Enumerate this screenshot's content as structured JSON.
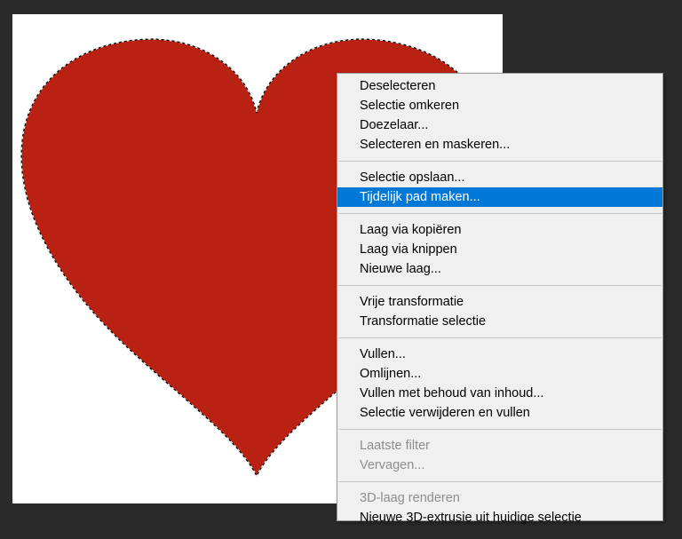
{
  "colors": {
    "workspace_background": "#2b2b2b",
    "canvas_background": "#ffffff",
    "heart_fill": "#b92213",
    "menu_background": "#f0f0f0",
    "menu_highlight": "#0078d7",
    "menu_text": "#000000",
    "menu_text_disabled": "#8d8d8d"
  },
  "canvas": {
    "shape": "heart-icon",
    "selection": "marching-ants"
  },
  "context_menu": {
    "groups": [
      [
        {
          "label": "Deselecteren",
          "enabled": true,
          "highlighted": false
        },
        {
          "label": "Selectie omkeren",
          "enabled": true,
          "highlighted": false
        },
        {
          "label": "Doezelaar...",
          "enabled": true,
          "highlighted": false
        },
        {
          "label": "Selecteren en maskeren...",
          "enabled": true,
          "highlighted": false
        }
      ],
      [
        {
          "label": "Selectie opslaan...",
          "enabled": true,
          "highlighted": false
        },
        {
          "label": "Tijdelijk pad maken...",
          "enabled": true,
          "highlighted": true
        }
      ],
      [
        {
          "label": "Laag via kopiëren",
          "enabled": true,
          "highlighted": false
        },
        {
          "label": "Laag via knippen",
          "enabled": true,
          "highlighted": false
        },
        {
          "label": "Nieuwe laag...",
          "enabled": true,
          "highlighted": false
        }
      ],
      [
        {
          "label": "Vrije transformatie",
          "enabled": true,
          "highlighted": false
        },
        {
          "label": "Transformatie selectie",
          "enabled": true,
          "highlighted": false
        }
      ],
      [
        {
          "label": "Vullen...",
          "enabled": true,
          "highlighted": false
        },
        {
          "label": "Omlijnen...",
          "enabled": true,
          "highlighted": false
        },
        {
          "label": "Vullen met behoud van inhoud...",
          "enabled": true,
          "highlighted": false
        },
        {
          "label": "Selectie verwijderen en vullen",
          "enabled": true,
          "highlighted": false
        }
      ],
      [
        {
          "label": "Laatste filter",
          "enabled": false,
          "highlighted": false
        },
        {
          "label": "Vervagen...",
          "enabled": false,
          "highlighted": false
        }
      ],
      [
        {
          "label": "3D-laag renderen",
          "enabled": false,
          "highlighted": false
        },
        {
          "label": "Nieuwe 3D-extrusie uit huidige selectie",
          "enabled": true,
          "highlighted": false
        }
      ]
    ]
  }
}
